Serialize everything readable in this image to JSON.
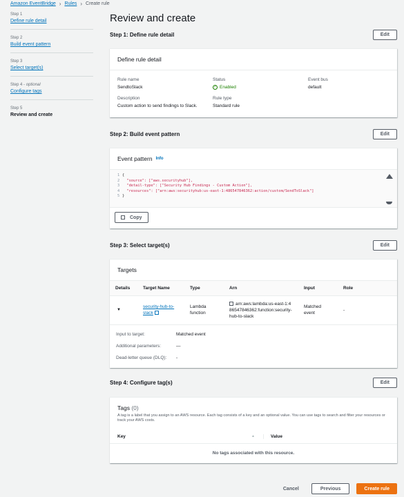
{
  "breadcrumb": {
    "items": [
      "Amazon EventBridge",
      "Rules"
    ],
    "current": "Create rule"
  },
  "sidebar": {
    "steps": [
      {
        "label": "Step 1",
        "title": "Define rule detail"
      },
      {
        "label": "Step 2",
        "title": "Build event pattern"
      },
      {
        "label": "Step 3",
        "title": "Select target(s)"
      },
      {
        "label": "Step 4",
        "optional": "optional",
        "title": "Configure tags"
      },
      {
        "label": "Step 5",
        "title": "Review and create"
      }
    ]
  },
  "page": {
    "title": "Review and create"
  },
  "edit_label": "Edit",
  "step1": {
    "title": "Step 1: Define rule detail",
    "card_title": "Define rule detail",
    "rule_name_key": "Rule name",
    "rule_name": "SendtoSlack",
    "status_key": "Status",
    "status": "Enabled",
    "event_bus_key": "Event bus",
    "event_bus": "default",
    "description_key": "Description",
    "description": "Custom action to send findings to Slack.",
    "rule_type_key": "Rule type",
    "rule_type": "Standard rule"
  },
  "step2": {
    "title": "Step 2: Build event pattern",
    "card_title": "Event pattern",
    "info": "Info",
    "code": [
      "{",
      "  \"source\": [\"aws.securityhub\"],",
      "  \"detail-type\": [\"Security Hub Findings - Custom Action\"],",
      "  \"resources\": [\"arn:aws:securityhub:us-east-1:486547846362:action/custom/SendToSlack\"]",
      "}"
    ],
    "copy_label": "Copy"
  },
  "step3": {
    "title": "Step 3: Select target(s)",
    "card_title": "Targets",
    "columns": [
      "Details",
      "Target Name",
      "Type",
      "Arn",
      "Input",
      "Role"
    ],
    "row": {
      "target_name": "security-hub-to-slack",
      "type": "Lambda function",
      "arn": "arn:aws:lambda:us-east-1:486547846362:function:security-hub-to-slack",
      "input": "Matched event",
      "role": "-"
    },
    "input_to_target_key": "Input to target:",
    "input_to_target": "Matched event",
    "additional_params_key": "Additional parameters:",
    "additional_params": "—",
    "dlq_key": "Dead-letter queue (DLQ):",
    "dlq": "-"
  },
  "step4": {
    "title": "Step 4: Configure tag(s)",
    "tags_title": "Tags",
    "tags_count": "(0)",
    "tags_desc": "A tag is a label that you assign to an AWS resource. Each tag consists of a key and an optional value. You can use tags to search and filter your resources or track your AWS costs.",
    "col_key": "Key",
    "col_value": "Value",
    "empty": "No tags associated with this resource."
  },
  "footer": {
    "cancel": "Cancel",
    "previous": "Previous",
    "create": "Create rule"
  },
  "colors": {
    "primary": "#ec7211",
    "link": "#0073bb",
    "success": "#1d8102"
  }
}
